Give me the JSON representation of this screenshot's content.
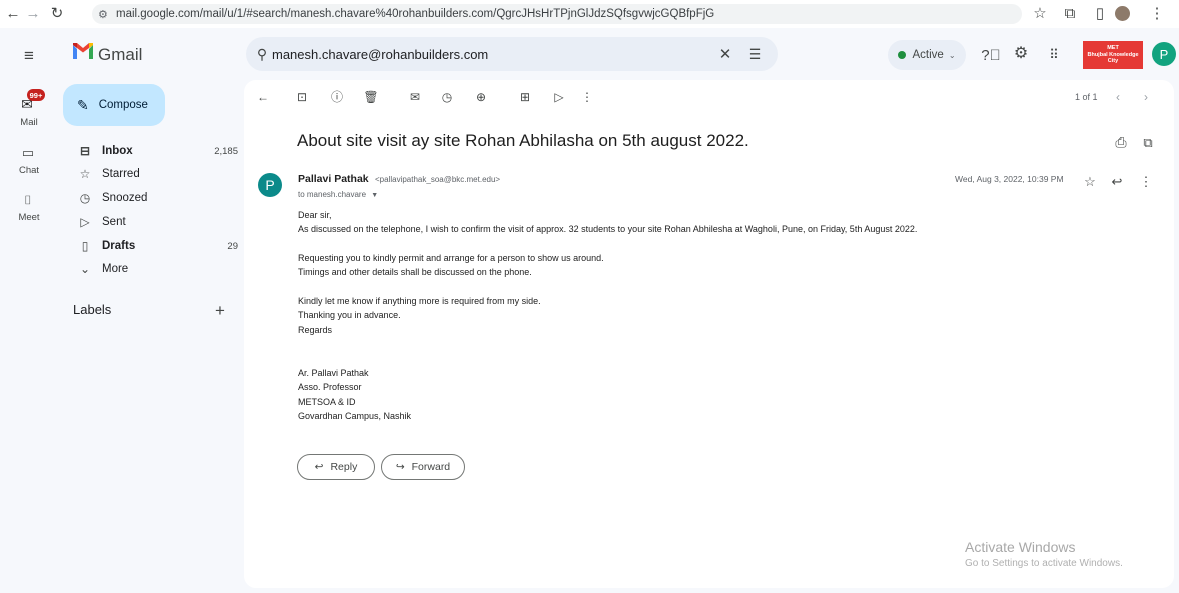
{
  "browser": {
    "url": "mail.google.com/mail/u/1/#search/manesh.chavare%40rohanbuilders.com/QgrcJHsHrTPjnGlJdzSQfsgvwjcGQBfpFjG"
  },
  "app": {
    "name": "Gmail"
  },
  "search": {
    "query": "manesh.chavare@rohanbuilders.com"
  },
  "status": {
    "label": "Active"
  },
  "brand": {
    "org_logo_line1": "MET",
    "org_logo_line2": "Bhujbal Knowledge City"
  },
  "account": {
    "avatar_letter": "P"
  },
  "rail": {
    "badge": "99+",
    "mail": "Mail",
    "chat": "Chat",
    "meet": "Meet"
  },
  "compose": {
    "label": "Compose"
  },
  "nav": {
    "items": [
      {
        "label": "Inbox",
        "count": "2,185"
      },
      {
        "label": "Starred",
        "count": ""
      },
      {
        "label": "Snoozed",
        "count": ""
      },
      {
        "label": "Sent",
        "count": ""
      },
      {
        "label": "Drafts",
        "count": "29"
      },
      {
        "label": "More",
        "count": ""
      }
    ]
  },
  "labels": {
    "title": "Labels"
  },
  "toolbar": {
    "pagination": "1 of 1"
  },
  "email": {
    "subject": "About site visit ay site Rohan Abhilasha on 5th august 2022.",
    "sender_initial": "P",
    "sender_name": "Pallavi Pathak",
    "sender_email": "<pallavipathak_soa@bkc.met.edu>",
    "to": "to manesh.chavare",
    "date": "Wed, Aug 3, 2022, 10:39 PM",
    "body": {
      "l1": "Dear sir,",
      "l2": "As discussed on the telephone, I wish to confirm the visit of approx. 32 students to your site Rohan Abhilesha at Wagholi, Pune, on Friday, 5th August 2022.",
      "l3": "Requesting you to kindly permit and arrange for a person to show us around.",
      "l4": "Timings and other details shall be discussed on the phone.",
      "l5": "Kindly let me know if anything more is required from my side.",
      "l6": "Thanking you in advance.",
      "l7": "Regards",
      "l8": "Ar. Pallavi Pathak",
      "l9": "Asso. Professor",
      "l10": "METSOA & ID",
      "l11": "Govardhan Campus, Nashik"
    },
    "reply_label": "Reply",
    "forward_label": "Forward"
  },
  "watermark": {
    "title": "Activate Windows",
    "subtitle": "Go to Settings to activate Windows."
  },
  "colors": {
    "compose_bg": "#c2e7ff",
    "active_dot": "#1e8e3e",
    "badge": "#c5221f",
    "org_logo": "#e53935"
  }
}
